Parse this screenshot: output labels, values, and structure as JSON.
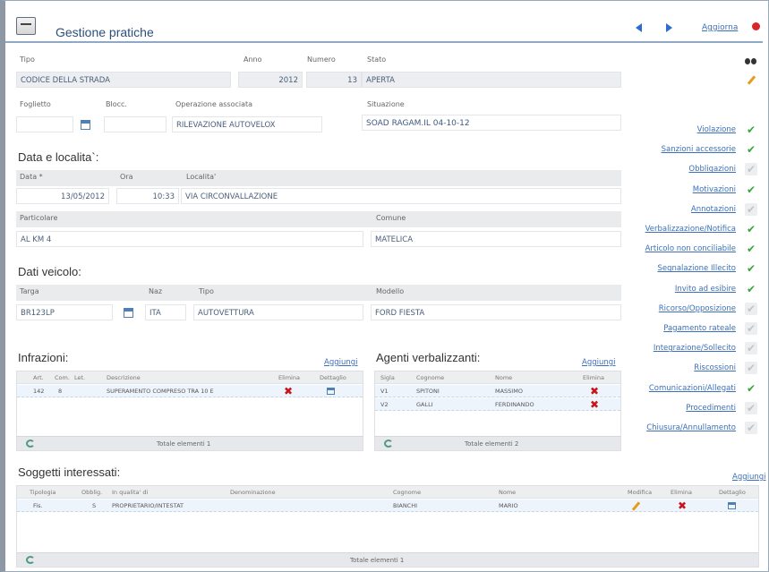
{
  "header": {
    "title": "Gestione pratiche",
    "link": "Aggiorna"
  },
  "practice": {
    "labels": {
      "tipo": "Tipo",
      "anno": "Anno",
      "numero": "Numero",
      "stato": "Stato",
      "foglietto": "Foglietto",
      "blocc": "Blocc.",
      "operazione": "Operazione associata",
      "situazione": "Situazione"
    },
    "tipo": "CODICE DELLA STRADA",
    "anno": "2012",
    "numero": "13",
    "stato": "APERTA",
    "foglietto": "",
    "blocc": "",
    "operazione": "RILEVAZIONE AUTOVELOX",
    "situazione": "SOAD RAGAM.IL 04-10-12"
  },
  "data_localita": {
    "heading": "Data e localita`:",
    "labels": {
      "data": "Data *",
      "ora": "Ora",
      "localita": "Localita'",
      "particolare": "Particolare",
      "comune": "Comune"
    },
    "data": "13/05/2012",
    "ora": "10:33",
    "localita": "VIA CIRCONVALLAZIONE",
    "particolare": "AL KM 4",
    "comune": "MATELICA"
  },
  "veicolo": {
    "heading": "Dati veicolo:",
    "labels": {
      "targa": "Targa",
      "naz": "Naz",
      "tipo": "Tipo",
      "modello": "Modello"
    },
    "targa": "BR123LP",
    "naz": "ITA",
    "tipo": "AUTOVETTURA",
    "modello": "FORD FIESTA"
  },
  "right_menu": [
    {
      "label": "Violazione",
      "status": "on"
    },
    {
      "label": "Sanzioni accessorie",
      "status": "on"
    },
    {
      "label": "Obbligazioni",
      "status": "off"
    },
    {
      "label": "Motivazioni",
      "status": "on"
    },
    {
      "label": "Annotazioni",
      "status": "off"
    },
    {
      "label": "Verbalizzazione/Notifica",
      "status": "on"
    },
    {
      "label": "Articolo non conciliabile",
      "status": "on"
    },
    {
      "label": "Segnalazione Illecito",
      "status": "on"
    },
    {
      "label": "Invito ad esibire",
      "status": "on"
    },
    {
      "label": "Ricorso/Opposizione",
      "status": "off"
    },
    {
      "label": "Pagamento rateale",
      "status": "off"
    },
    {
      "label": "Integrazione/Sollecito",
      "status": "off"
    },
    {
      "label": "Riscossioni",
      "status": "off"
    },
    {
      "label": "Comunicazioni/Allegati",
      "status": "on"
    },
    {
      "label": "Procedimenti",
      "status": "off"
    },
    {
      "label": "Chiusura/Annullamento",
      "status": "off"
    }
  ],
  "infrazioni": {
    "heading": "Infrazioni:",
    "add_link": "Aggiungi",
    "columns": [
      "Art.",
      "Com.",
      "Let.",
      "Descrizione",
      "Elimina",
      "Dettaglio"
    ],
    "rows": [
      {
        "art": "142",
        "com": "8",
        "let": "",
        "descrizione": "SUPERAMENTO COMPRESO TRA 10 E"
      }
    ],
    "footer": "Totale elementi 1"
  },
  "agenti": {
    "heading": "Agenti verbalizzanti:",
    "add_link": "Aggiungi",
    "columns": [
      "Sigla",
      "Cognome",
      "Nome",
      "Elimina"
    ],
    "rows": [
      {
        "sigla": "V1",
        "cognome": "SPITONI",
        "nome": "MASSIMO"
      },
      {
        "sigla": "V2",
        "cognome": "GALLI",
        "nome": "FERDINANDO"
      }
    ],
    "footer": "Totale elementi 2"
  },
  "soggetti": {
    "heading": "Soggetti interessati:",
    "add_link": "Aggiungi",
    "columns": [
      "Tipologia",
      "Obblig.",
      "In qualita' di",
      "Denominazione",
      "Cognome",
      "Nome",
      "Modifica",
      "Elimina",
      "Dettaglio"
    ],
    "rows": [
      {
        "tipologia": "Fis.",
        "obblig": "S",
        "qualita": "PROPRIETARIO/INTESTAT",
        "denominazione": "",
        "cognome": "BIANCHI",
        "nome": "MARIO"
      }
    ],
    "footer": "Totale elementi 1"
  }
}
